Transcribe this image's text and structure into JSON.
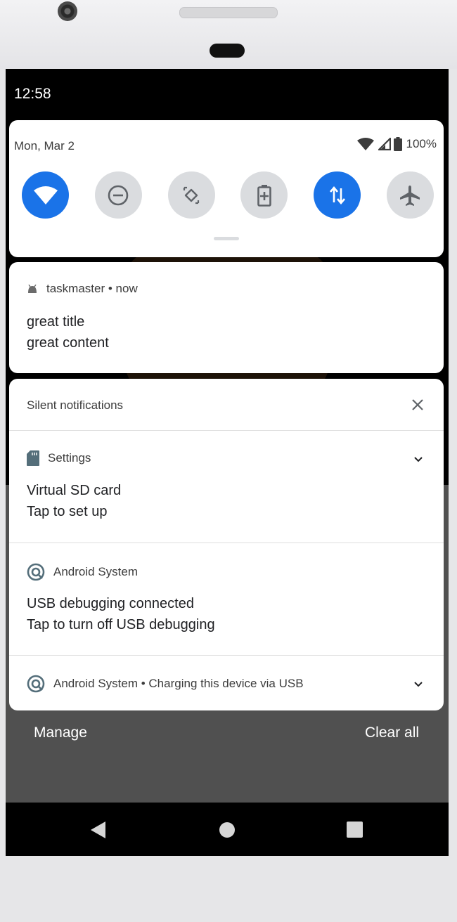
{
  "status_bar": {
    "time": "12:58"
  },
  "quick_settings": {
    "date": "Mon, Mar 2",
    "battery": "100%",
    "tiles": [
      {
        "icon": "wifi-icon",
        "active": true
      },
      {
        "icon": "do-not-disturb-icon",
        "active": false
      },
      {
        "icon": "auto-rotate-icon",
        "active": false
      },
      {
        "icon": "battery-saver-icon",
        "active": false
      },
      {
        "icon": "mobile-data-icon",
        "active": true
      },
      {
        "icon": "airplane-mode-icon",
        "active": false
      }
    ]
  },
  "notification": {
    "app": "taskmaster",
    "time": "now",
    "title": "great title",
    "content": "great content"
  },
  "silent": {
    "header": "Silent notifications",
    "items": [
      {
        "app": "Settings",
        "title": "Virtual SD card",
        "text": "Tap to set up"
      },
      {
        "app": "Android System",
        "title": "USB debugging connected",
        "text": "Tap to turn off USB debugging"
      },
      {
        "app": "Android System",
        "summary": "Charging this device via USB"
      }
    ]
  },
  "footer": {
    "manage": "Manage",
    "clear_all": "Clear all"
  },
  "colors": {
    "accent": "#1a73e8",
    "tile_off": "#dadcdf",
    "scrim": "#505050"
  }
}
